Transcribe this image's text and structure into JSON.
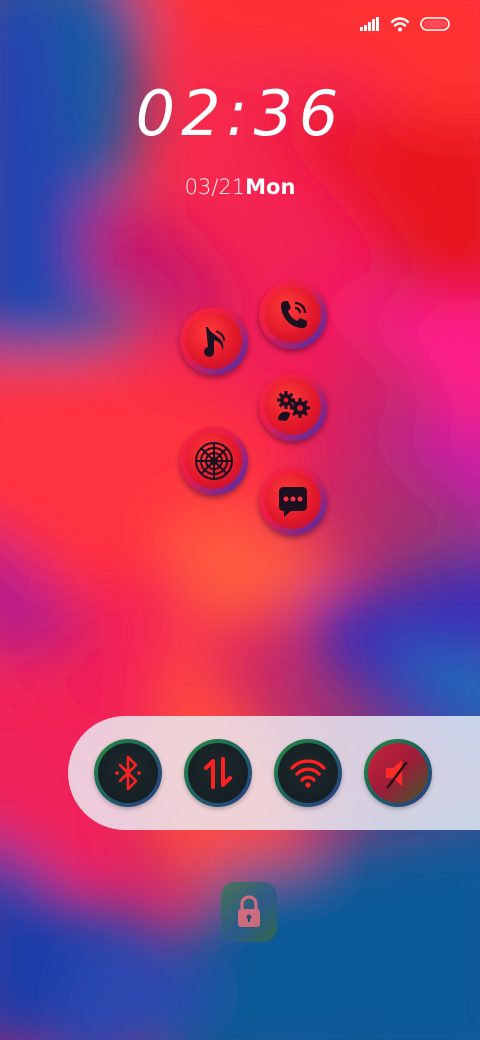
{
  "status_bar": {
    "signal_icon": "cellular-signal-icon",
    "wifi_icon": "wifi-icon",
    "battery_icon": "battery-icon"
  },
  "lockscreen": {
    "time": "02:36",
    "date": "03/21",
    "weekday": "Mon"
  },
  "apps": [
    {
      "name": "music",
      "icon": "music-note-icon"
    },
    {
      "name": "phone",
      "icon": "phone-icon"
    },
    {
      "name": "settings",
      "icon": "gears-icon"
    },
    {
      "name": "radar",
      "icon": "radar-icon"
    },
    {
      "name": "messages",
      "icon": "chat-bubble-icon"
    }
  ],
  "quick_toggles": [
    {
      "name": "bluetooth",
      "icon": "bluetooth-icon"
    },
    {
      "name": "mobile-data",
      "icon": "data-arrows-icon"
    },
    {
      "name": "wifi",
      "icon": "wifi-icon"
    },
    {
      "name": "sound",
      "icon": "speaker-muted-icon"
    }
  ],
  "lock": {
    "icon": "padlock-icon"
  },
  "colors": {
    "accent_red": "#ff2030",
    "icon_glyph": "#1a1020",
    "toggle_glyph": "#ff2020",
    "panel": "#ecf0f6"
  }
}
